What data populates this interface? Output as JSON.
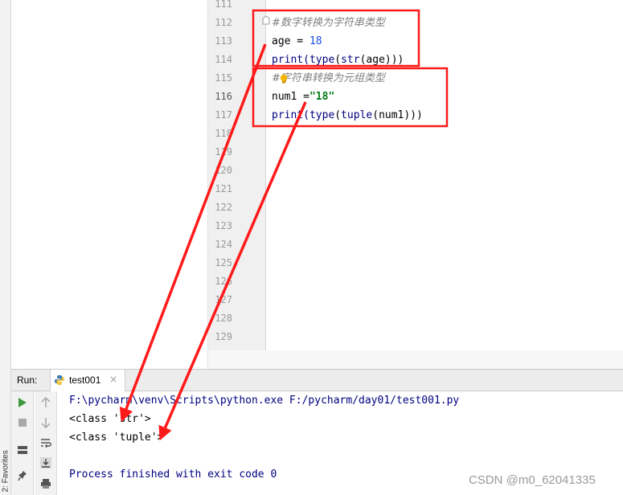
{
  "editor": {
    "line_numbers": [
      "111",
      "112",
      "113",
      "114",
      "115",
      "116",
      "117",
      "118",
      "119",
      "120",
      "121",
      "122",
      "123",
      "124",
      "125",
      "126",
      "127",
      "128",
      "129"
    ],
    "current_line": "116",
    "code": {
      "l112_comment": "#数字转换为字符串类型",
      "l113_a": "age = ",
      "l113_num": "18",
      "l114_a": "print(",
      "l114_type": "type",
      "l114_b": "(",
      "l114_str": "str",
      "l114_c": "(age)))",
      "l115_comment": "#字符串转换为元组类型",
      "l116_a": "num1 =",
      "l116_str": "\"18\"",
      "l117_a": "print(",
      "l117_type": "type",
      "l117_b": "(",
      "l117_tuple": "tuple",
      "l117_c": "(num1)))"
    }
  },
  "run_panel": {
    "label": "Run:",
    "tab_name": "test001",
    "tab_close": "×",
    "console": {
      "command": "F:\\pycharm\\venv\\Scripts\\python.exe F:/pycharm/day01/test001.py",
      "out1": "<class 'str'>",
      "out2": "<class 'tuple'>",
      "finished": "Process finished with exit code 0"
    }
  },
  "side_tab": "2: Favorites",
  "watermark": "CSDN @m0_62041335",
  "colors": {
    "annotation": "#ff1a1a",
    "keyword_builtin": "#000080",
    "number": "#1750eb",
    "string": "#067d17",
    "comment": "#808080"
  }
}
